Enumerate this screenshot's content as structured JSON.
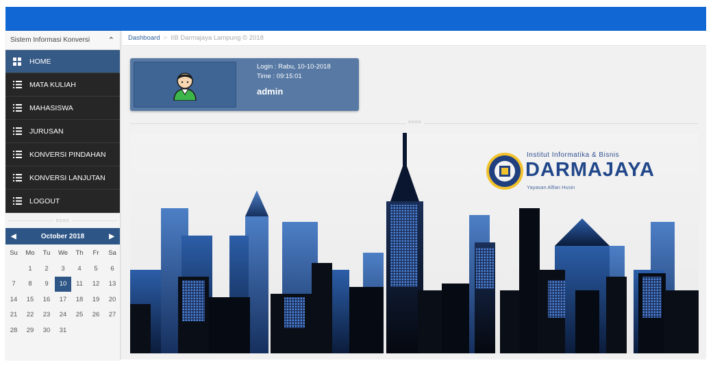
{
  "sidebar": {
    "title": "Sistem Informasi Konversi",
    "items": [
      {
        "label": "HOME"
      },
      {
        "label": "MATA KULIAH"
      },
      {
        "label": "MAHASISWA"
      },
      {
        "label": "JURUSAN"
      },
      {
        "label": "KONVERSI PINDAHAN"
      },
      {
        "label": "KONVERSI LANJUTAN"
      },
      {
        "label": "LOGOUT"
      }
    ],
    "divider": "oooo"
  },
  "calendar": {
    "month": "October 2018",
    "weekdays": [
      "Su",
      "Mo",
      "Tu",
      "We",
      "Th",
      "Fr",
      "Sa"
    ],
    "days": [
      "",
      "1",
      "2",
      "3",
      "4",
      "5",
      "6",
      "7",
      "8",
      "9",
      "10",
      "11",
      "12",
      "13",
      "14",
      "15",
      "16",
      "17",
      "18",
      "19",
      "20",
      "21",
      "22",
      "23",
      "24",
      "25",
      "26",
      "27",
      "28",
      "29",
      "30",
      "31"
    ],
    "selected": "10"
  },
  "breadcrumb": {
    "link": "Dashboard",
    "separator": ">",
    "current": "IIB Darmajaya Lampung © 2018"
  },
  "user": {
    "login": "Login : Rabu, 10-10-2018",
    "time": "Time : 09:15:01",
    "name": "admin"
  },
  "main": {
    "divider": "oooo"
  },
  "logo": {
    "title": "Institut Informatika & Bisnis",
    "brand": "DARMAJAYA",
    "subtitle": "Yayasan Alfian Husin"
  },
  "colors": {
    "topbar": "#1168d4",
    "active_menu": "#355a85",
    "menu_bg": "#262626",
    "card": "#5779a4",
    "brand": "#21478a"
  }
}
